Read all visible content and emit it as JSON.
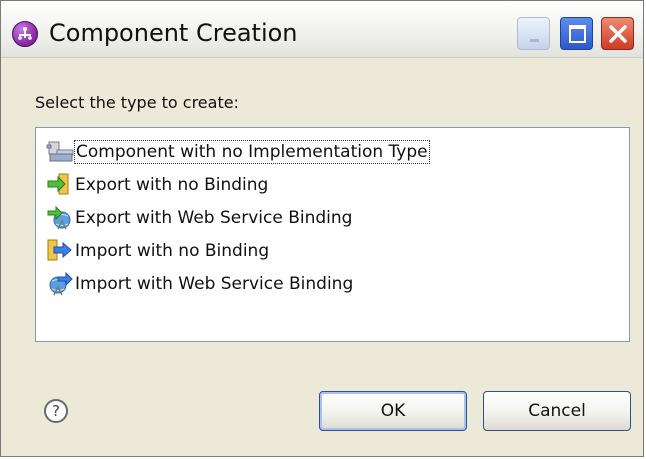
{
  "window": {
    "title": "Component Creation",
    "icon": "component-app-icon",
    "controls": [
      "minimize-icon",
      "maximize-icon",
      "close-icon"
    ]
  },
  "prompt": "Select the type to create:",
  "list": {
    "items": [
      {
        "label": "Component with no Implementation Type",
        "icon": "component-icon",
        "selected": true
      },
      {
        "label": "Export with no Binding",
        "icon": "export-icon"
      },
      {
        "label": "Export with Web Service Binding",
        "icon": "export-web-service-icon"
      },
      {
        "label": "Import with no Binding",
        "icon": "import-icon"
      },
      {
        "label": "Import with Web Service Binding",
        "icon": "import-web-service-icon"
      }
    ]
  },
  "buttons": {
    "help": "?",
    "ok": "OK",
    "cancel": "Cancel"
  }
}
